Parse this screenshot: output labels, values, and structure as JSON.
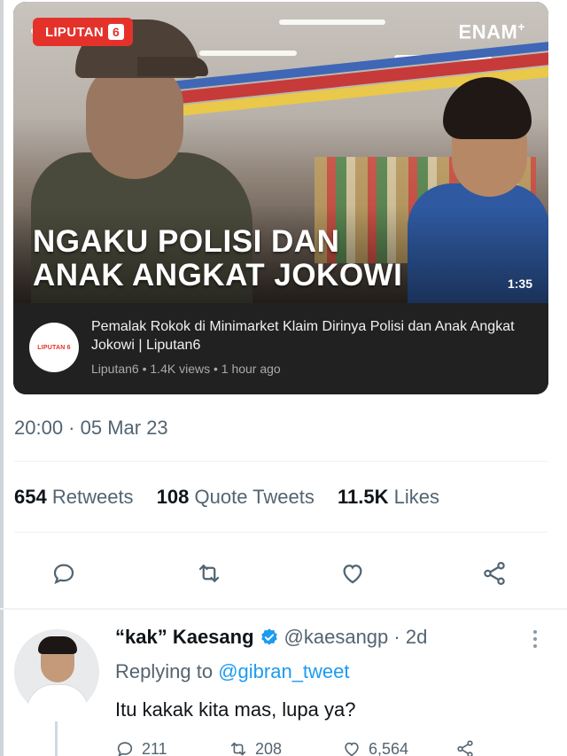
{
  "video": {
    "badge_text": "LIPUTAN",
    "badge_number": "6",
    "brand_text": "ENAM",
    "brand_sup": "+",
    "headline_line1": "NGAKU POLISI DAN",
    "headline_line2": "ANAK ANGKAT JOKOWI",
    "duration": "1:35",
    "channel_avatar_text": "LIPUTAN 6",
    "title": "Pemalak Rokok di Minimarket Klaim Dirinya Polisi dan Anak Angkat Jokowi | Liputan6",
    "sub": "Liputan6 • 1.4K views • 1 hour ago"
  },
  "tweet": {
    "timestamp": "20:00 · 05 Mar 23",
    "retweets_count": "654",
    "retweets_label": "Retweets",
    "quotes_count": "108",
    "quotes_label": "Quote Tweets",
    "likes_count": "11.5K",
    "likes_label": "Likes"
  },
  "actions": [
    "reply-icon",
    "retweet-icon",
    "like-icon",
    "share-icon"
  ],
  "reply": {
    "name": "“kak” Kaesang",
    "handle": "@kaesangp · 2d",
    "replying_prefix": "Replying to",
    "replying_to": "@gibran_tweet",
    "text": "Itu kakak kita mas, lupa ya?",
    "reply_count": "211",
    "retweet_count": "208",
    "like_count": "6,564"
  },
  "colors": {
    "accent": "#1d9bf0",
    "muted": "#536471",
    "liputan_red": "#e4322b"
  }
}
